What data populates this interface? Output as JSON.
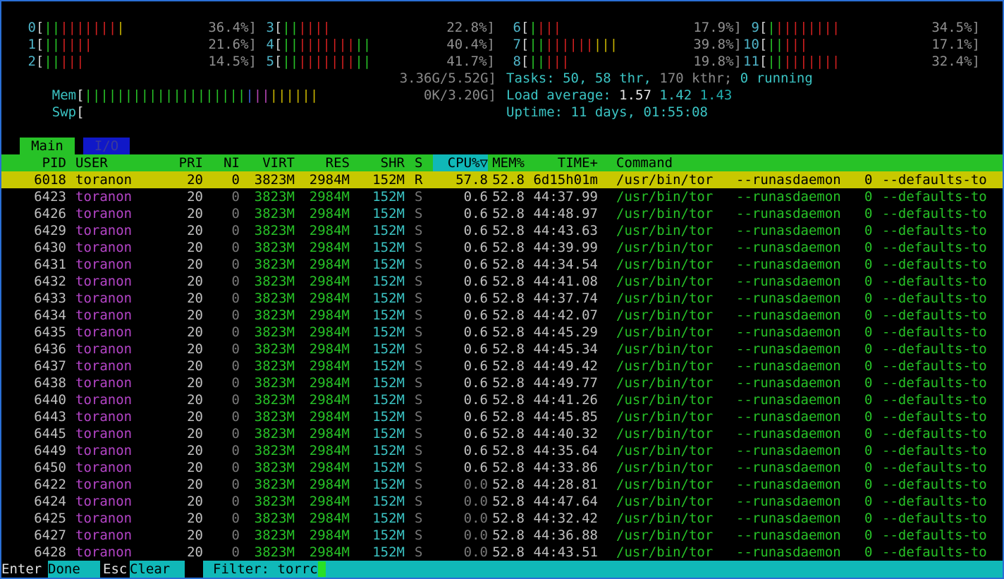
{
  "cpus": [
    {
      "id": "0",
      "pct": "36.4%]",
      "bars": [
        [
          "g",
          2
        ],
        [
          "r",
          7
        ],
        [
          "y",
          1
        ]
      ]
    },
    {
      "id": "1",
      "pct": "21.6%]",
      "bars": [
        [
          "g",
          2
        ],
        [
          "r",
          4
        ]
      ]
    },
    {
      "id": "2",
      "pct": "14.5%]",
      "bars": [
        [
          "g",
          2
        ],
        [
          "r",
          3
        ]
      ]
    },
    {
      "id": "3",
      "pct": "22.8%]",
      "bars": [
        [
          "g",
          2
        ],
        [
          "r",
          4
        ]
      ]
    },
    {
      "id": "4",
      "pct": "40.4%]",
      "bars": [
        [
          "g",
          2
        ],
        [
          "r",
          7
        ],
        [
          "g",
          2
        ]
      ]
    },
    {
      "id": "5",
      "pct": "41.7%]",
      "bars": [
        [
          "g",
          2
        ],
        [
          "r",
          7
        ],
        [
          "g",
          2
        ]
      ]
    },
    {
      "id": "6",
      "pct": "17.9%]",
      "bars": [
        [
          "g",
          1
        ],
        [
          "r",
          3
        ]
      ]
    },
    {
      "id": "7",
      "pct": "39.8%]",
      "bars": [
        [
          "g",
          2
        ],
        [
          "r",
          6
        ],
        [
          "y",
          3
        ]
      ]
    },
    {
      "id": "8",
      "pct": "19.8%]",
      "bars": [
        [
          "g",
          2
        ],
        [
          "r",
          3
        ]
      ]
    },
    {
      "id": "9",
      "pct": "34.5%]",
      "bars": [
        [
          "g",
          1
        ],
        [
          "r",
          8
        ]
      ]
    },
    {
      "id": "10",
      "pct": "17.1%]",
      "bars": [
        [
          "g",
          2
        ],
        [
          "r",
          3
        ]
      ]
    },
    {
      "id": "11",
      "pct": "32.4%]",
      "bars": [
        [
          "g",
          2
        ],
        [
          "r",
          7
        ]
      ]
    }
  ],
  "mem": {
    "label": "Mem",
    "value": "3.36G/5.52G]",
    "bars": [
      [
        "g",
        20
      ],
      [
        "b",
        1
      ],
      [
        "m",
        2
      ],
      [
        "y",
        6
      ]
    ]
  },
  "swp": {
    "label": "Swp",
    "value": "0K/3.20G]"
  },
  "tasks": {
    "label": "Tasks: ",
    "count": "50",
    "sep": ", ",
    "thr": "58",
    "thr_label": " thr, ",
    "kthr": "170",
    "kthr_label": " kthr; ",
    "running": "0",
    "running_label": " running"
  },
  "load": {
    "label": "Load average: ",
    "l1": "1.57",
    "l5": "1.42",
    "l15": "1.43"
  },
  "uptime": {
    "label": "Uptime: ",
    "value": "11 days, 01:55:08"
  },
  "tabs": {
    "main": "Main",
    "io": "I/O"
  },
  "columns": {
    "pid": "PID",
    "user": "USER",
    "pri": "PRI",
    "ni": "NI",
    "virt": "VIRT",
    "res": "RES",
    "shr": "SHR",
    "s": "S",
    "cpu": "CPU%▽",
    "mem": "MEM%",
    "time": "TIME+",
    "cmd": "Command"
  },
  "processes": [
    {
      "pid": "6018",
      "user": "toranon",
      "pri": "20",
      "ni": "0",
      "virt": "3823M",
      "res": "2984M",
      "shr": "152M",
      "s": "R",
      "cpu": "57.8",
      "mem": "52.8",
      "time": "6d15h01m",
      "cmd1": "/usr/bin/tor",
      "cmd2": "--runasdaemon",
      "cmd3": "0",
      "cmd4": "--defaults-to"
    },
    {
      "pid": "6423",
      "user": "toranon",
      "pri": "20",
      "ni": "0",
      "virt": "3823M",
      "res": "2984M",
      "shr": "152M",
      "s": "S",
      "cpu": "0.6",
      "mem": "52.8",
      "time": "44:37.99",
      "cmd1": "/usr/bin/tor",
      "cmd2": "--runasdaemon",
      "cmd3": "0",
      "cmd4": "--defaults-to"
    },
    {
      "pid": "6426",
      "user": "toranon",
      "pri": "20",
      "ni": "0",
      "virt": "3823M",
      "res": "2984M",
      "shr": "152M",
      "s": "S",
      "cpu": "0.6",
      "mem": "52.8",
      "time": "44:48.97",
      "cmd1": "/usr/bin/tor",
      "cmd2": "--runasdaemon",
      "cmd3": "0",
      "cmd4": "--defaults-to"
    },
    {
      "pid": "6429",
      "user": "toranon",
      "pri": "20",
      "ni": "0",
      "virt": "3823M",
      "res": "2984M",
      "shr": "152M",
      "s": "S",
      "cpu": "0.6",
      "mem": "52.8",
      "time": "44:43.63",
      "cmd1": "/usr/bin/tor",
      "cmd2": "--runasdaemon",
      "cmd3": "0",
      "cmd4": "--defaults-to"
    },
    {
      "pid": "6430",
      "user": "toranon",
      "pri": "20",
      "ni": "0",
      "virt": "3823M",
      "res": "2984M",
      "shr": "152M",
      "s": "S",
      "cpu": "0.6",
      "mem": "52.8",
      "time": "44:39.99",
      "cmd1": "/usr/bin/tor",
      "cmd2": "--runasdaemon",
      "cmd3": "0",
      "cmd4": "--defaults-to"
    },
    {
      "pid": "6431",
      "user": "toranon",
      "pri": "20",
      "ni": "0",
      "virt": "3823M",
      "res": "2984M",
      "shr": "152M",
      "s": "S",
      "cpu": "0.6",
      "mem": "52.8",
      "time": "44:34.54",
      "cmd1": "/usr/bin/tor",
      "cmd2": "--runasdaemon",
      "cmd3": "0",
      "cmd4": "--defaults-to"
    },
    {
      "pid": "6432",
      "user": "toranon",
      "pri": "20",
      "ni": "0",
      "virt": "3823M",
      "res": "2984M",
      "shr": "152M",
      "s": "S",
      "cpu": "0.6",
      "mem": "52.8",
      "time": "44:41.08",
      "cmd1": "/usr/bin/tor",
      "cmd2": "--runasdaemon",
      "cmd3": "0",
      "cmd4": "--defaults-to"
    },
    {
      "pid": "6433",
      "user": "toranon",
      "pri": "20",
      "ni": "0",
      "virt": "3823M",
      "res": "2984M",
      "shr": "152M",
      "s": "S",
      "cpu": "0.6",
      "mem": "52.8",
      "time": "44:37.74",
      "cmd1": "/usr/bin/tor",
      "cmd2": "--runasdaemon",
      "cmd3": "0",
      "cmd4": "--defaults-to"
    },
    {
      "pid": "6434",
      "user": "toranon",
      "pri": "20",
      "ni": "0",
      "virt": "3823M",
      "res": "2984M",
      "shr": "152M",
      "s": "S",
      "cpu": "0.6",
      "mem": "52.8",
      "time": "44:42.07",
      "cmd1": "/usr/bin/tor",
      "cmd2": "--runasdaemon",
      "cmd3": "0",
      "cmd4": "--defaults-to"
    },
    {
      "pid": "6435",
      "user": "toranon",
      "pri": "20",
      "ni": "0",
      "virt": "3823M",
      "res": "2984M",
      "shr": "152M",
      "s": "S",
      "cpu": "0.6",
      "mem": "52.8",
      "time": "44:45.29",
      "cmd1": "/usr/bin/tor",
      "cmd2": "--runasdaemon",
      "cmd3": "0",
      "cmd4": "--defaults-to"
    },
    {
      "pid": "6436",
      "user": "toranon",
      "pri": "20",
      "ni": "0",
      "virt": "3823M",
      "res": "2984M",
      "shr": "152M",
      "s": "S",
      "cpu": "0.6",
      "mem": "52.8",
      "time": "44:45.34",
      "cmd1": "/usr/bin/tor",
      "cmd2": "--runasdaemon",
      "cmd3": "0",
      "cmd4": "--defaults-to"
    },
    {
      "pid": "6437",
      "user": "toranon",
      "pri": "20",
      "ni": "0",
      "virt": "3823M",
      "res": "2984M",
      "shr": "152M",
      "s": "S",
      "cpu": "0.6",
      "mem": "52.8",
      "time": "44:49.42",
      "cmd1": "/usr/bin/tor",
      "cmd2": "--runasdaemon",
      "cmd3": "0",
      "cmd4": "--defaults-to"
    },
    {
      "pid": "6438",
      "user": "toranon",
      "pri": "20",
      "ni": "0",
      "virt": "3823M",
      "res": "2984M",
      "shr": "152M",
      "s": "S",
      "cpu": "0.6",
      "mem": "52.8",
      "time": "44:49.77",
      "cmd1": "/usr/bin/tor",
      "cmd2": "--runasdaemon",
      "cmd3": "0",
      "cmd4": "--defaults-to"
    },
    {
      "pid": "6440",
      "user": "toranon",
      "pri": "20",
      "ni": "0",
      "virt": "3823M",
      "res": "2984M",
      "shr": "152M",
      "s": "S",
      "cpu": "0.6",
      "mem": "52.8",
      "time": "44:41.26",
      "cmd1": "/usr/bin/tor",
      "cmd2": "--runasdaemon",
      "cmd3": "0",
      "cmd4": "--defaults-to"
    },
    {
      "pid": "6443",
      "user": "toranon",
      "pri": "20",
      "ni": "0",
      "virt": "3823M",
      "res": "2984M",
      "shr": "152M",
      "s": "S",
      "cpu": "0.6",
      "mem": "52.8",
      "time": "44:45.85",
      "cmd1": "/usr/bin/tor",
      "cmd2": "--runasdaemon",
      "cmd3": "0",
      "cmd4": "--defaults-to"
    },
    {
      "pid": "6445",
      "user": "toranon",
      "pri": "20",
      "ni": "0",
      "virt": "3823M",
      "res": "2984M",
      "shr": "152M",
      "s": "S",
      "cpu": "0.6",
      "mem": "52.8",
      "time": "44:40.32",
      "cmd1": "/usr/bin/tor",
      "cmd2": "--runasdaemon",
      "cmd3": "0",
      "cmd4": "--defaults-to"
    },
    {
      "pid": "6449",
      "user": "toranon",
      "pri": "20",
      "ni": "0",
      "virt": "3823M",
      "res": "2984M",
      "shr": "152M",
      "s": "S",
      "cpu": "0.6",
      "mem": "52.8",
      "time": "44:35.64",
      "cmd1": "/usr/bin/tor",
      "cmd2": "--runasdaemon",
      "cmd3": "0",
      "cmd4": "--defaults-to"
    },
    {
      "pid": "6450",
      "user": "toranon",
      "pri": "20",
      "ni": "0",
      "virt": "3823M",
      "res": "2984M",
      "shr": "152M",
      "s": "S",
      "cpu": "0.6",
      "mem": "52.8",
      "time": "44:33.86",
      "cmd1": "/usr/bin/tor",
      "cmd2": "--runasdaemon",
      "cmd3": "0",
      "cmd4": "--defaults-to"
    },
    {
      "pid": "6422",
      "user": "toranon",
      "pri": "20",
      "ni": "0",
      "virt": "3823M",
      "res": "2984M",
      "shr": "152M",
      "s": "S",
      "cpu": "0.0",
      "mem": "52.8",
      "time": "44:28.81",
      "cmd1": "/usr/bin/tor",
      "cmd2": "--runasdaemon",
      "cmd3": "0",
      "cmd4": "--defaults-to"
    },
    {
      "pid": "6424",
      "user": "toranon",
      "pri": "20",
      "ni": "0",
      "virt": "3823M",
      "res": "2984M",
      "shr": "152M",
      "s": "S",
      "cpu": "0.0",
      "mem": "52.8",
      "time": "44:47.64",
      "cmd1": "/usr/bin/tor",
      "cmd2": "--runasdaemon",
      "cmd3": "0",
      "cmd4": "--defaults-to"
    },
    {
      "pid": "6425",
      "user": "toranon",
      "pri": "20",
      "ni": "0",
      "virt": "3823M",
      "res": "2984M",
      "shr": "152M",
      "s": "S",
      "cpu": "0.0",
      "mem": "52.8",
      "time": "44:32.42",
      "cmd1": "/usr/bin/tor",
      "cmd2": "--runasdaemon",
      "cmd3": "0",
      "cmd4": "--defaults-to"
    },
    {
      "pid": "6427",
      "user": "toranon",
      "pri": "20",
      "ni": "0",
      "virt": "3823M",
      "res": "2984M",
      "shr": "152M",
      "s": "S",
      "cpu": "0.0",
      "mem": "52.8",
      "time": "44:36.88",
      "cmd1": "/usr/bin/tor",
      "cmd2": "--runasdaemon",
      "cmd3": "0",
      "cmd4": "--defaults-to"
    },
    {
      "pid": "6428",
      "user": "toranon",
      "pri": "20",
      "ni": "0",
      "virt": "3823M",
      "res": "2984M",
      "shr": "152M",
      "s": "S",
      "cpu": "0.0",
      "mem": "52.8",
      "time": "44:43.51",
      "cmd1": "/usr/bin/tor",
      "cmd2": "--runasdaemon",
      "cmd3": "0",
      "cmd4": "--defaults-to"
    }
  ],
  "footer": {
    "enter_key": "Enter",
    "enter_label": "Done",
    "esc_key": "Esc",
    "esc_label": "Clear",
    "filter_label": "Filter: ",
    "filter_value": "torrc"
  },
  "colors": {
    "green": "#27c227",
    "cyan": "#3bc4c4",
    "magenta": "#b545c8",
    "selected_row": "#c8c800",
    "footer_bg": "#10b8b8",
    "tab_io": "#1018c8"
  }
}
